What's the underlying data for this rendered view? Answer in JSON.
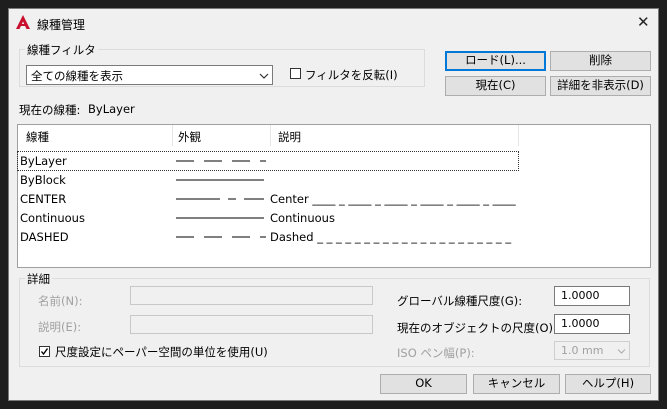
{
  "window": {
    "title": "線種管理"
  },
  "filter": {
    "group_label": "線種フィルタ",
    "selected": "全ての線種を表示",
    "invert_label": "フィルタを反転(I)",
    "invert_checked": false
  },
  "buttons": {
    "load": "ロード(L)...",
    "delete": "削除",
    "current": "現在(C)",
    "hide_details": "詳細を非表示(D)",
    "ok": "OK",
    "cancel": "キャンセル",
    "help": "ヘルプ(H)"
  },
  "current_linetype": {
    "label": "現在の線種:",
    "value": "ByLayer"
  },
  "list": {
    "headers": [
      "線種",
      "外観",
      "説明"
    ],
    "rows": [
      {
        "name": "ByLayer",
        "appearance": "dashed",
        "desc": ""
      },
      {
        "name": "ByBlock",
        "appearance": "solid",
        "desc": ""
      },
      {
        "name": "CENTER",
        "appearance": "center",
        "desc": "Center ____ _ ____ _ ____ _ ____ _ ____ _ ____"
      },
      {
        "name": "Continuous",
        "appearance": "solid",
        "desc": "Continuous"
      },
      {
        "name": "DASHED",
        "appearance": "dashed",
        "desc": "Dashed _ _ _ _ _ _ _ _ _ _ _ _ _ _ _ _ _ _ _ _ _"
      }
    ]
  },
  "details": {
    "group_label": "詳細",
    "name_label": "名前(N):",
    "desc_label": "説明(E):",
    "paper_space_label": "尺度設定にペーパー空間の単位を使用(U)",
    "paper_space_checked": true,
    "global_scale_label": "グローバル線種尺度(G):",
    "global_scale_value": "1.0000",
    "object_scale_label": "現在のオブジェクトの尺度(O):",
    "object_scale_value": "1.0000",
    "iso_pen_label": "ISO ペン幅(P):",
    "iso_pen_value": "1.0 mm"
  },
  "colors": {
    "accent": "#0078d7",
    "logo_red": "#c8102e"
  }
}
